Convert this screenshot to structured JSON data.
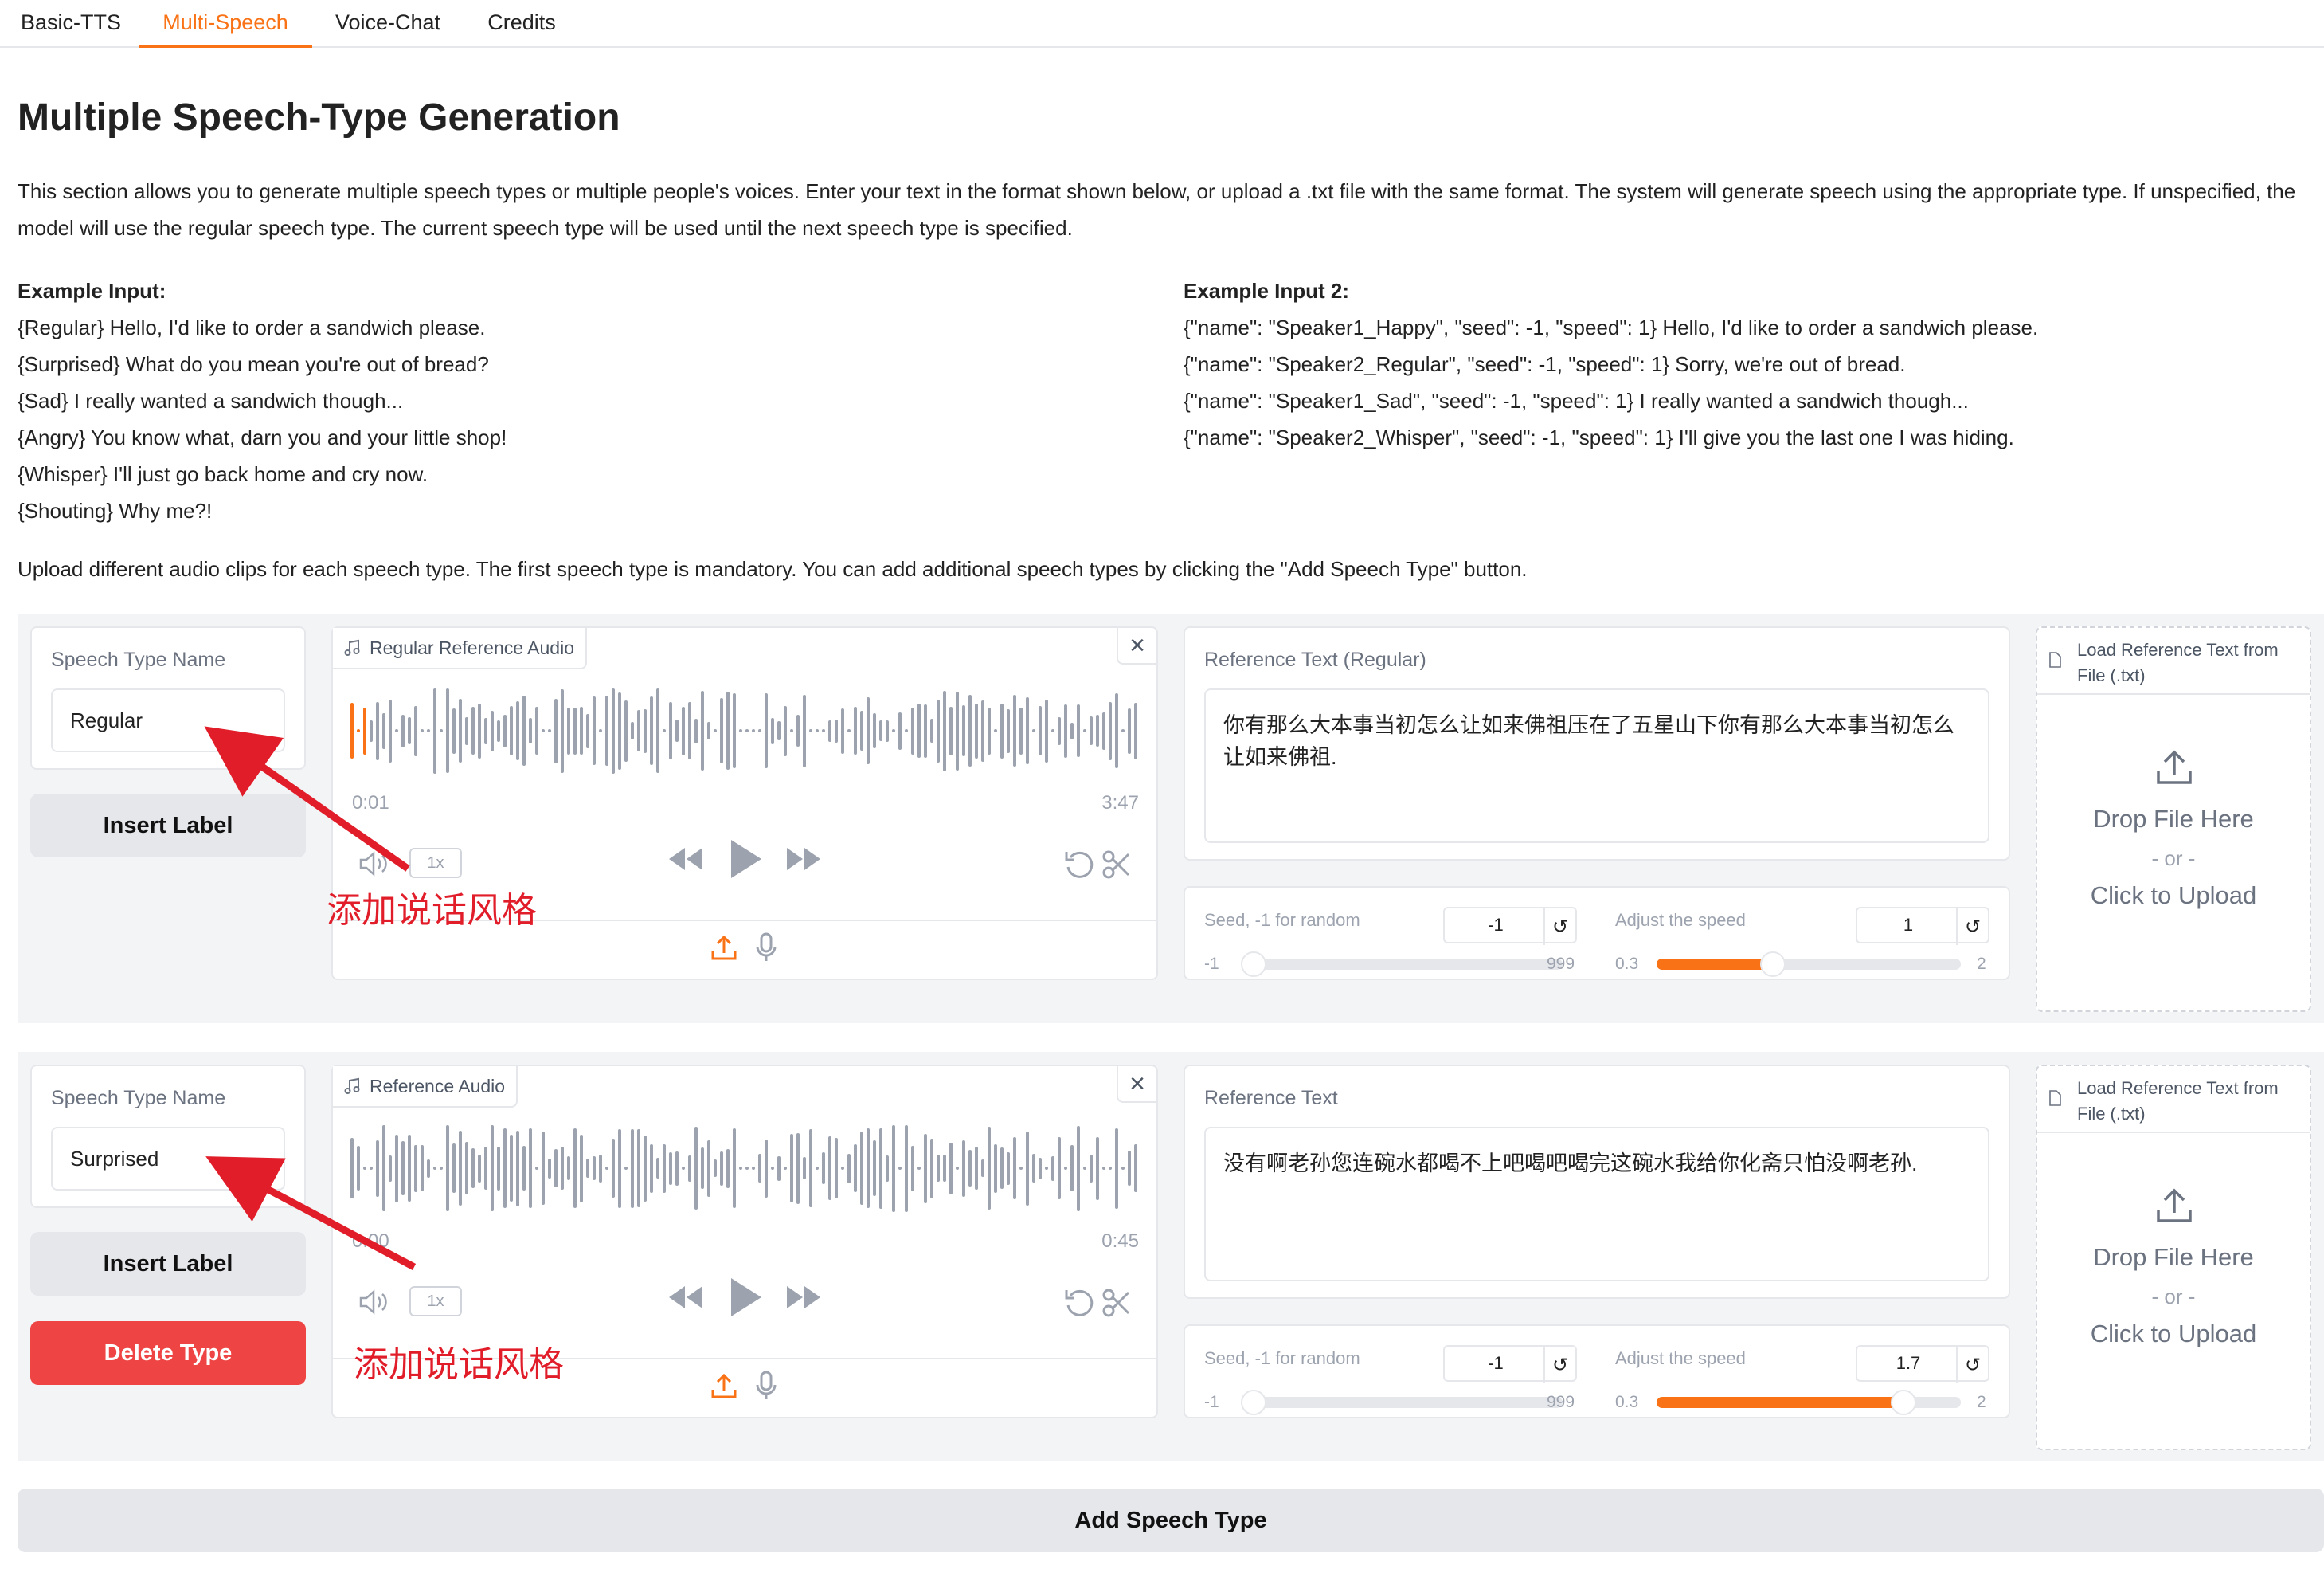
{
  "tabs": [
    "Basic-TTS",
    "Multi-Speech",
    "Voice-Chat",
    "Credits"
  ],
  "title": "Multiple Speech-Type Generation",
  "intro_line1": "This section allows you to generate multiple speech types or multiple people's voices. Enter your text in the format shown below, or upload a .txt file with the same format. The system will generate speech using the appropriate type. If unspecified, the",
  "intro_line2": "model will use the regular speech type. The current speech type will be used until the next speech type is specified.",
  "example1": {
    "heading": "Example Input:",
    "lines": [
      "{Regular} Hello, I'd like to order a sandwich please.",
      "{Surprised} What do you mean you're out of bread?",
      "{Sad} I really wanted a sandwich though...",
      "{Angry} You know what, darn you and your little shop!",
      "{Whisper} I'll just go back home and cry now.",
      "{Shouting} Why me?!"
    ]
  },
  "example2": {
    "heading": "Example Input 2:",
    "lines": [
      "{\"name\": \"Speaker1_Happy\", \"seed\": -1, \"speed\": 1} Hello, I'd like to order a sandwich please.",
      "{\"name\": \"Speaker2_Regular\", \"seed\": -1, \"speed\": 1} Sorry, we're out of bread.",
      "{\"name\": \"Speaker1_Sad\", \"seed\": -1, \"speed\": 1} I really wanted a sandwich though...",
      "{\"name\": \"Speaker2_Whisper\", \"seed\": -1, \"speed\": 1} I'll give you the last one I was hiding."
    ]
  },
  "upload_note": "Upload different audio clips for each speech type. The first speech type is mandatory. You can add additional speech types by clicking the \"Add Speech Type\" button.",
  "rows": [
    {
      "name_label": "Speech Type Name",
      "name_value": "Regular",
      "insert_label": "Insert Label",
      "audio_label": "Regular Reference Audio",
      "time_start": "0:01",
      "time_end": "3:47",
      "speed_rate": "1x",
      "ref_label": "Reference Text (Regular)",
      "ref_text": "你有那么大本事当初怎么让如来佛祖压在了五星山下你有那么大本事当初怎么让如来佛祖.",
      "seed_label": "Seed, -1 for random",
      "seed_value": "-1",
      "seed_min": "-1",
      "seed_max": "999",
      "speed_label": "Adjust the speed",
      "speed_value": "1",
      "speed_min": "0.3",
      "speed_max": "2",
      "load_label": "Load Reference Text from File (.txt)",
      "drop": "Drop File Here",
      "or": "- or -",
      "click": "Click to Upload",
      "annotation": "添加说话风格"
    },
    {
      "name_label": "Speech Type Name",
      "name_value": "Surprised",
      "insert_label": "Insert Label",
      "delete_label": "Delete Type",
      "audio_label": "Reference Audio",
      "time_start": "0:00",
      "time_end": "0:45",
      "speed_rate": "1x",
      "ref_label": "Reference Text",
      "ref_text": "没有啊老孙您连碗水都喝不上吧喝吧喝完这碗水我给你化斋只怕没啊老孙.",
      "seed_label": "Seed, -1 for random",
      "seed_value": "-1",
      "seed_min": "-1",
      "seed_max": "999",
      "speed_label": "Adjust the speed",
      "speed_value": "1.7",
      "speed_min": "0.3",
      "speed_max": "2",
      "load_label": "Load Reference Text from File (.txt)",
      "drop": "Drop File Here",
      "or": "- or -",
      "click": "Click to Upload",
      "annotation": "添加说话风格"
    }
  ],
  "add_button": "Add Speech Type",
  "colors": {
    "accent": "#f97316",
    "danger": "#ef4444",
    "annotation": "#e11d2a"
  }
}
